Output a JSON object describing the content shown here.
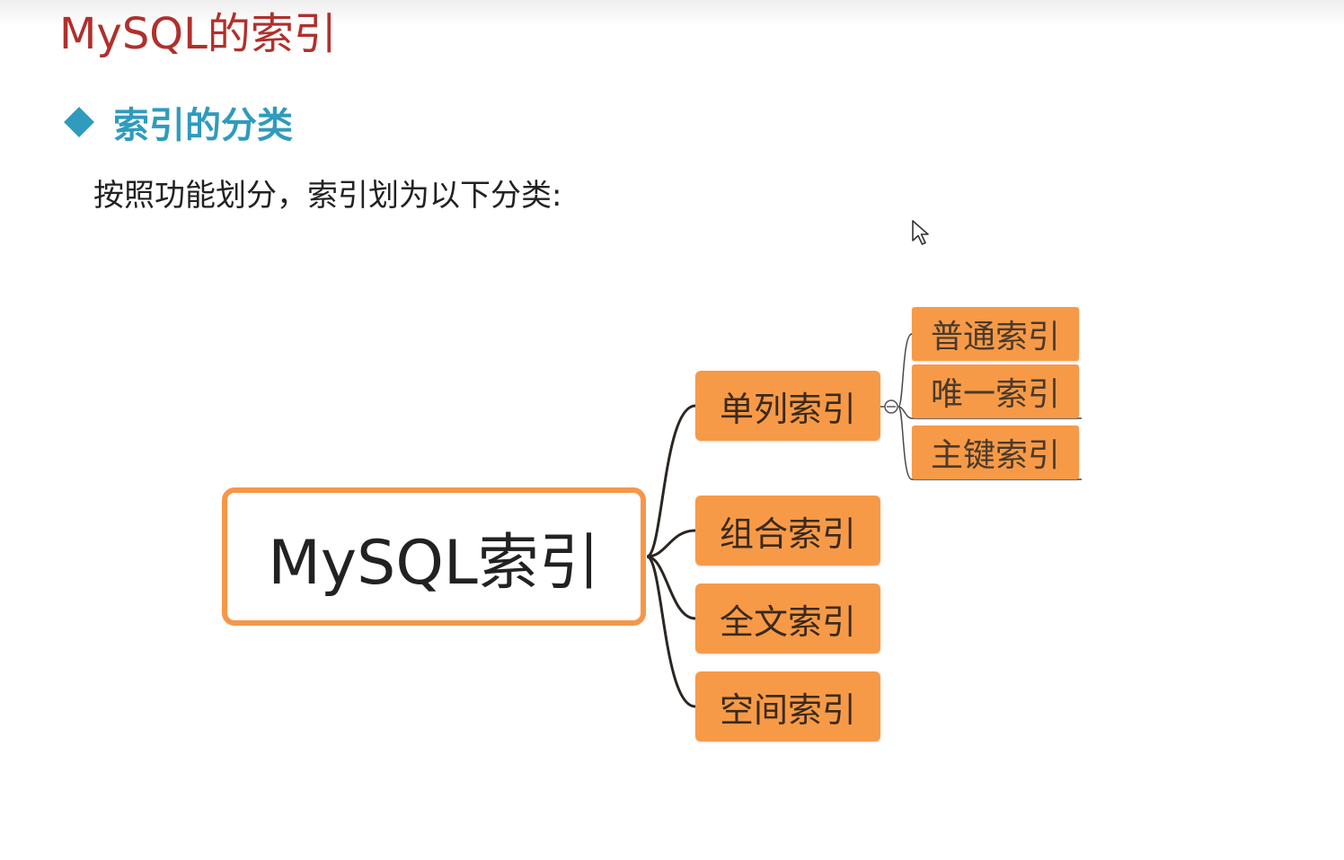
{
  "slide": {
    "title": "MySQL的索引",
    "section_title": "索引的分类",
    "description": "按照功能划分，索引划为以下分类:"
  },
  "mindmap": {
    "root": "MySQL索引",
    "children": [
      {
        "label": "单列索引",
        "children": [
          {
            "label": "普通索引"
          },
          {
            "label": "唯一索引"
          },
          {
            "label": "主键索引"
          }
        ]
      },
      {
        "label": "组合索引"
      },
      {
        "label": "全文索引"
      },
      {
        "label": "空间索引"
      }
    ]
  },
  "colors": {
    "title": "#b0302c",
    "section": "#2f9bbd",
    "node_fill": "#f79a47",
    "root_border": "#f59748",
    "connector": "#2b2622"
  }
}
